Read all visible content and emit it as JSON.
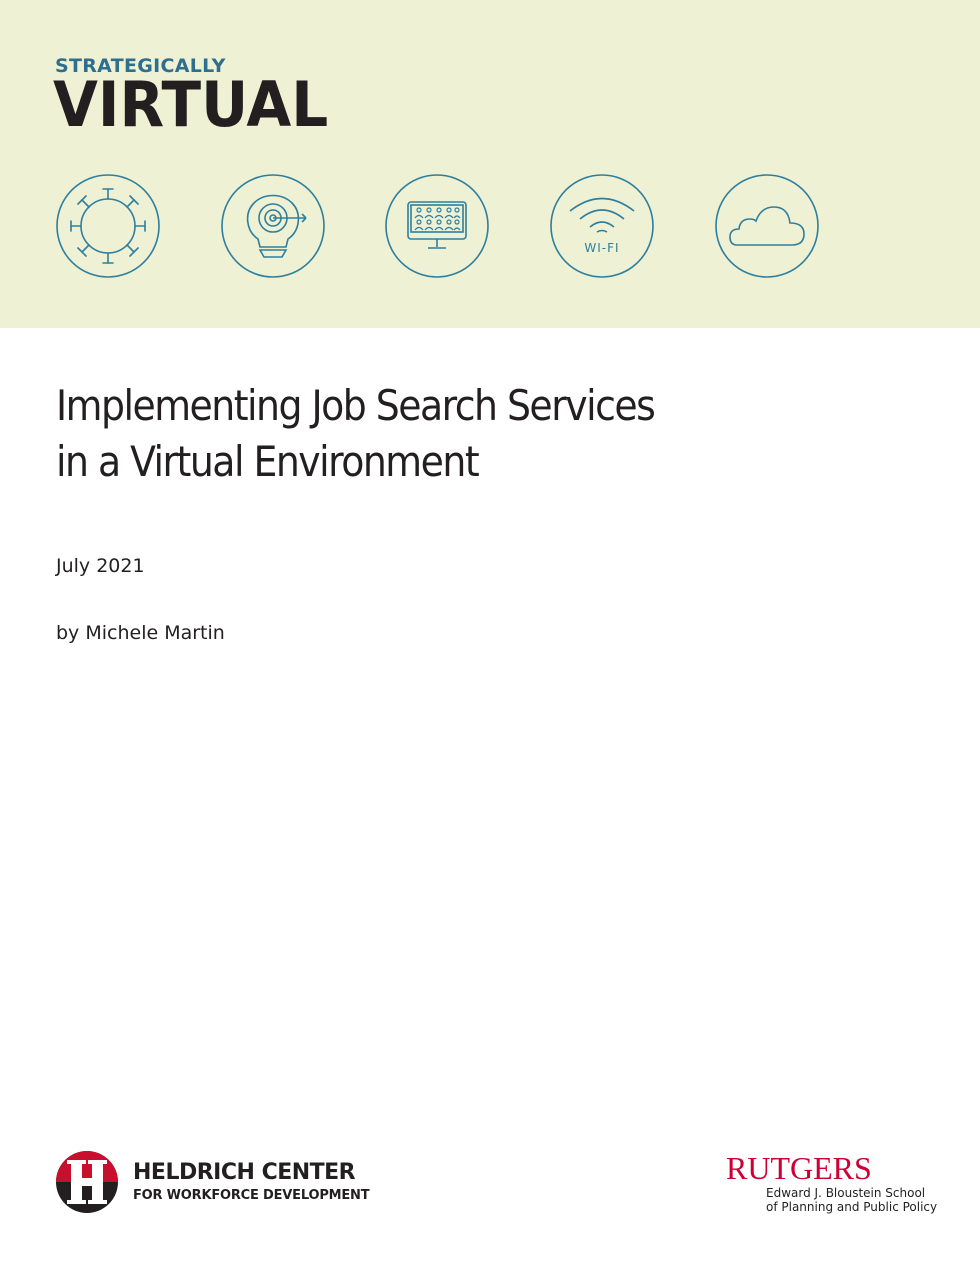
{
  "header": {
    "kicker": "STRATEGICALLY",
    "series_title": "VIRTUAL",
    "background_color": "#eef1d3",
    "accent_color": "#2e6f8e",
    "icons": [
      "virus-icon",
      "lightbulb-target-icon",
      "monitor-meeting-icon",
      "wifi-icon",
      "cloud-icon"
    ],
    "wifi_label": "WI-FI"
  },
  "document": {
    "title_line1": "Implementing Job Search Services",
    "title_line2": "in a Virtual Environment",
    "date": "July 2021",
    "author": "by Michele Martin"
  },
  "footer": {
    "heldrich_name": "HELDRICH CENTER",
    "heldrich_sub": "FOR WORKFORCE DEVELOPMENT",
    "rutgers_word": "RUTGERS",
    "rutgers_line1": "Edward J. Bloustein School",
    "rutgers_line2": "of Planning and Public Policy",
    "rutgers_color": "#cc0033"
  }
}
